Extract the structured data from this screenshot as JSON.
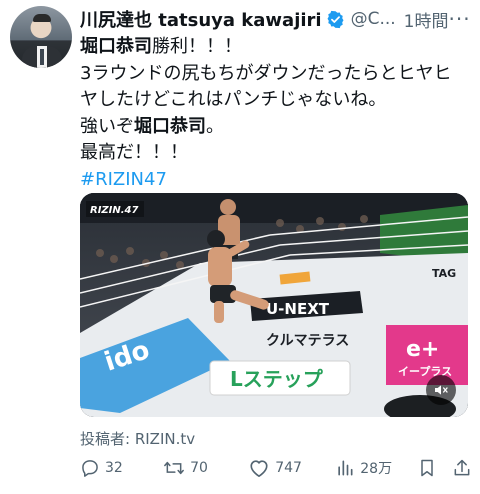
{
  "author": {
    "name": "川尻達也 tatsuya kawajiri",
    "handle": "@C...",
    "time": "1時間"
  },
  "tweet": {
    "line1_bold": "堀口恭司",
    "line1_rest": "勝利！！！",
    "line2": "3ラウンドの尻もちがダウンだったらとヒヤヒ",
    "line3": "ヤしたけどこれはパンチじゃないね。",
    "line4_start": "強いぞ",
    "line4_bold": "堀口恭司",
    "line4_end": "。",
    "line5": "最高だ！！！",
    "hashtag": "#RIZIN47"
  },
  "media": {
    "broadcast_logo": "RIZIN.47",
    "mat_texts": [
      "U-NEXT",
      "クルマテラス",
      "Lステップ",
      "イープラス",
      "e+",
      "ido",
      "TAG"
    ]
  },
  "source": "投稿者: RIZIN.tv",
  "actions": {
    "replies": "32",
    "reposts": "70",
    "likes": "747",
    "views": "28万"
  },
  "colors": {
    "link": "#1d9bf0",
    "muted": "#536471",
    "text": "#0f1419"
  }
}
